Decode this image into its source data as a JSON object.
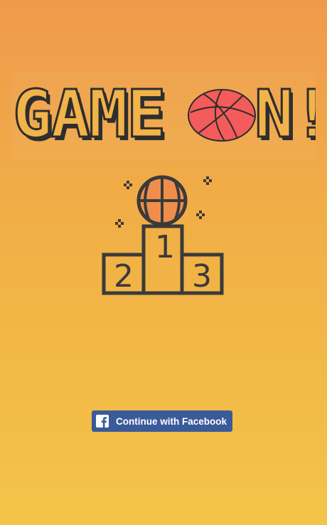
{
  "logo": {
    "text": "GAME",
    "text_end": "N!",
    "ball_name": "basketball-icon",
    "fill_color": "#F2B349",
    "stroke_color": "#2E2E2E",
    "ball_color": "#F45B5B"
  },
  "podium": {
    "first": "1",
    "second": "2",
    "third": "3",
    "ball_color": "#EE8E4A",
    "line_color": "#3A3A3A"
  },
  "facebook": {
    "label": "Continue with Facebook",
    "icon": "facebook-icon",
    "button_color": "#3B5A9A"
  }
}
